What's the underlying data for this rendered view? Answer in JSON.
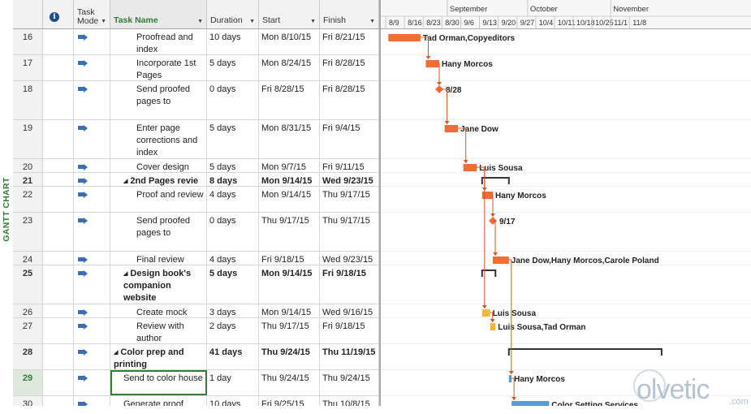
{
  "view_label": "GANTT CHART",
  "columns": {
    "mode": "Task Mode",
    "name": "Task Name",
    "duration": "Duration",
    "start": "Start",
    "finish": "Finish"
  },
  "timescale": {
    "months": [
      "September",
      "October",
      "November"
    ],
    "weeks": [
      "8/9",
      "8/16",
      "8/23",
      "8/30",
      "9/6",
      "9/13",
      "9/20",
      "9/27",
      "10/4",
      "10/11",
      "10/18",
      "10/25",
      "11/1",
      "11/8"
    ]
  },
  "colors": {
    "bar_critical": "#f26d36",
    "bar_normal": "#f5b73b",
    "bar_selected": "#5b9bd5",
    "summary": "#333333",
    "link": "#d9541e"
  },
  "tasks": [
    {
      "id": "16",
      "name": "Proofread and index",
      "duration": "10 days",
      "start": "Mon 8/10/15",
      "finish": "Fri 8/21/15",
      "summary": false,
      "level": 2,
      "selected": false,
      "resources": "Tad Orman,Copyeditors"
    },
    {
      "id": "17",
      "name": "Incorporate 1st Pages",
      "duration": "5 days",
      "start": "Mon 8/24/15",
      "finish": "Fri 8/28/15",
      "summary": false,
      "level": 2,
      "selected": false,
      "resources": "Hany Morcos"
    },
    {
      "id": "18",
      "name": "Send proofed pages to",
      "duration": "0 days",
      "start": "Fri 8/28/15",
      "finish": "Fri 8/28/15",
      "summary": false,
      "level": 2,
      "selected": false,
      "resources": "8/28"
    },
    {
      "id": "19",
      "name": "Enter page corrections and index",
      "duration": "5 days",
      "start": "Mon 8/31/15",
      "finish": "Fri 9/4/15",
      "summary": false,
      "level": 2,
      "selected": false,
      "resources": "Jane Dow"
    },
    {
      "id": "20",
      "name": "Cover design",
      "duration": "5 days",
      "start": "Mon 9/7/15",
      "finish": "Fri 9/11/15",
      "summary": false,
      "level": 2,
      "selected": false,
      "resources": "Luis Sousa"
    },
    {
      "id": "21",
      "name": "2nd Pages revie",
      "duration": "8 days",
      "start": "Mon 9/14/15",
      "finish": "Wed 9/23/15",
      "summary": true,
      "level": 1,
      "selected": false,
      "resources": ""
    },
    {
      "id": "22",
      "name": "Proof and review",
      "duration": "4 days",
      "start": "Mon 9/14/15",
      "finish": "Thu 9/17/15",
      "summary": false,
      "level": 2,
      "selected": false,
      "resources": "Hany Morcos"
    },
    {
      "id": "23",
      "name": "Send proofed pages to",
      "duration": "0 days",
      "start": "Thu 9/17/15",
      "finish": "Thu 9/17/15",
      "summary": false,
      "level": 2,
      "selected": false,
      "resources": "9/17"
    },
    {
      "id": "24",
      "name": "Final review",
      "duration": "4 days",
      "start": "Fri 9/18/15",
      "finish": "Wed 9/23/15",
      "summary": false,
      "level": 2,
      "selected": false,
      "resources": "Jane Dow,Hany Morcos,Carole Poland"
    },
    {
      "id": "25",
      "name": "Design book's companion website",
      "duration": "5 days",
      "start": "Mon 9/14/15",
      "finish": "Fri 9/18/15",
      "summary": true,
      "level": 1,
      "selected": false,
      "resources": ""
    },
    {
      "id": "26",
      "name": "Create mock",
      "duration": "3 days",
      "start": "Mon 9/14/15",
      "finish": "Wed 9/16/15",
      "summary": false,
      "level": 2,
      "selected": false,
      "resources": "Luis Sousa"
    },
    {
      "id": "27",
      "name": "Review with author",
      "duration": "2 days",
      "start": "Thu 9/17/15",
      "finish": "Fri 9/18/15",
      "summary": false,
      "level": 2,
      "selected": false,
      "resources": "Luis Sousa,Tad Orman"
    },
    {
      "id": "28",
      "name": "Color prep and printing",
      "duration": "41 days",
      "start": "Thu 9/24/15",
      "finish": "Thu 11/19/15",
      "summary": true,
      "level": 0,
      "selected": false,
      "resources": ""
    },
    {
      "id": "29",
      "name": "Send to color house",
      "duration": "1 day",
      "start": "Thu 9/24/15",
      "finish": "Thu 9/24/15",
      "summary": false,
      "level": 1,
      "selected": true,
      "resources": "Hany Morcos"
    },
    {
      "id": "30",
      "name": "Generate proof",
      "duration": "10 days",
      "start": "Fri 9/25/15",
      "finish": "Thu 10/8/15",
      "summary": false,
      "level": 1,
      "selected": false,
      "resources": "Color Setting Services"
    }
  ],
  "watermark": {
    "text": "olvetic",
    "domain": ".com"
  }
}
